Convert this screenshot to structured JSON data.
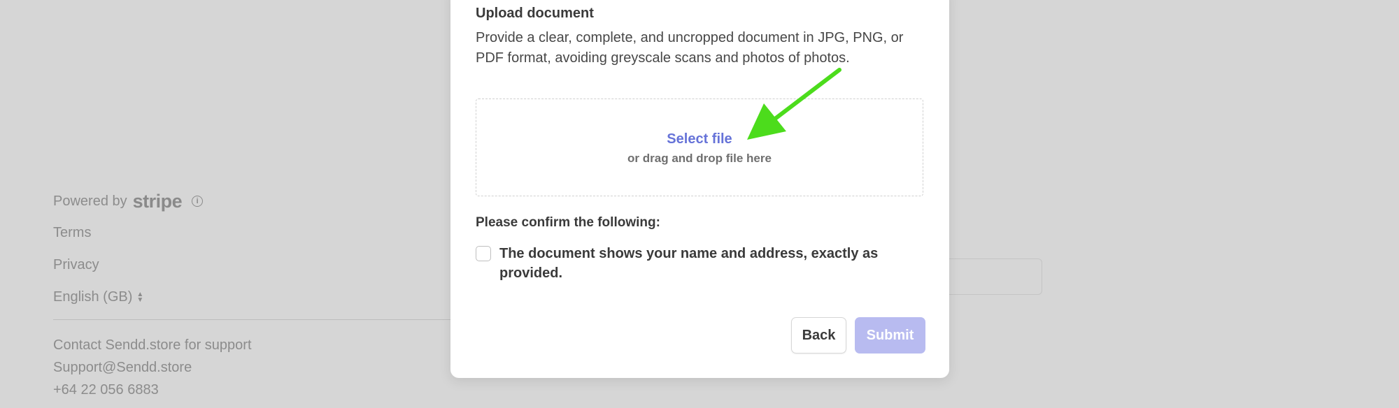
{
  "footer": {
    "powered_by": "Powered by",
    "brand": "stripe",
    "info_icon": "info-icon",
    "terms": "Terms",
    "privacy": "Privacy",
    "language": "English (GB)",
    "language_icon": "chevron-up-down-icon",
    "contact_line": "Contact Sendd.store for support",
    "email": "Support@Sendd.store",
    "phone": "+64 22 056 6883"
  },
  "modal": {
    "title": "Upload document",
    "description": "Provide a clear, complete, and uncropped document in JPG, PNG, or PDF format, avoiding greyscale scans and photos of photos.",
    "dropzone": {
      "select_label": "Select file",
      "drag_label": "or drag and drop file here"
    },
    "confirm_heading": "Please confirm the following:",
    "checkbox_label": "The document shows your name and address, exactly as provided.",
    "checkbox_checked": false,
    "back_label": "Back",
    "submit_label": "Submit",
    "submit_enabled": false
  },
  "colors": {
    "accent": "#6673d8",
    "submit_disabled": "#b8bbf0",
    "annotation_arrow": "#4cdc1c",
    "overlay": "#d6d6d6"
  }
}
